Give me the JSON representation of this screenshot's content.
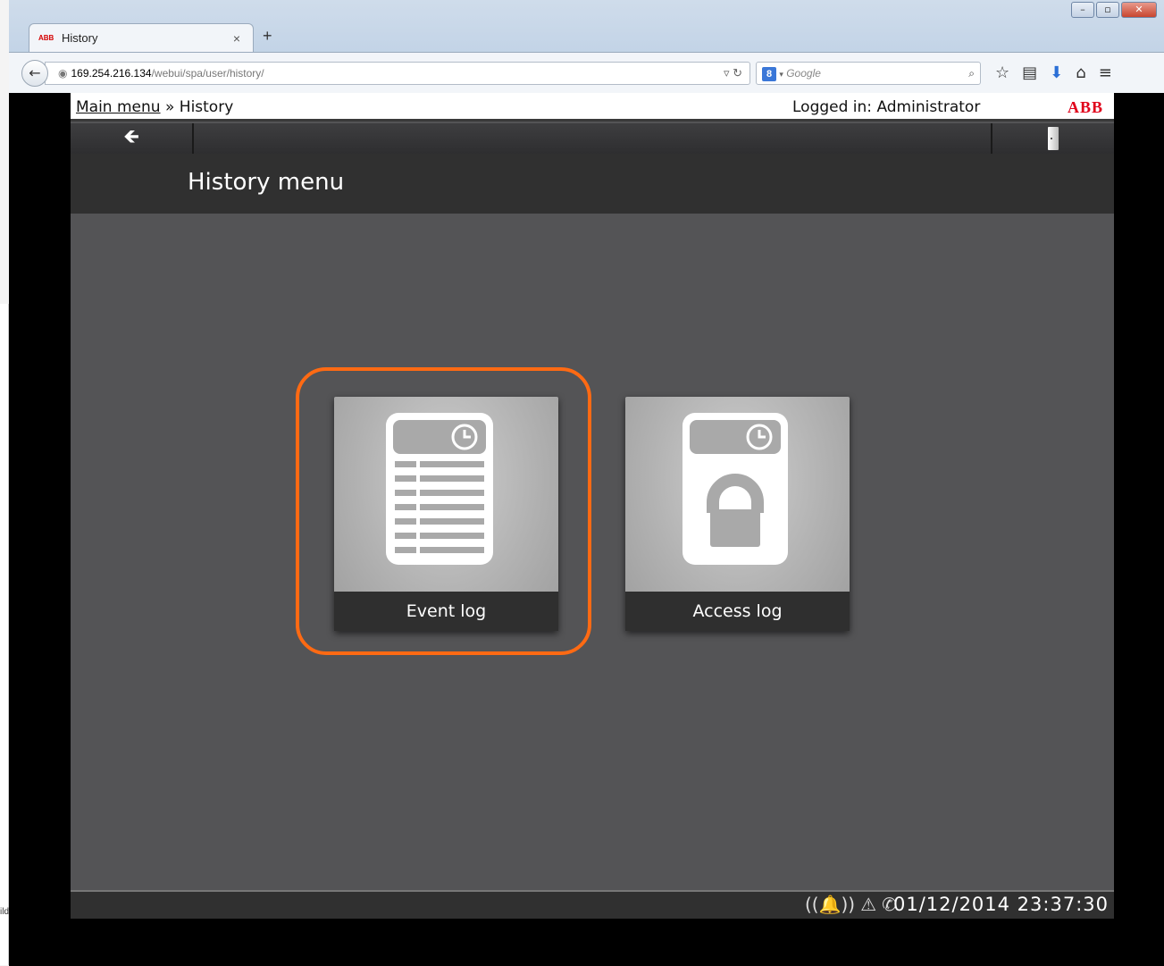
{
  "browser": {
    "tab_title": "History",
    "tab_favicon": "ABB",
    "tab_close": "×",
    "new_tab": "+",
    "url_host": "169.254.216.134",
    "url_path": "/webui/spa/user/history/",
    "search_placeholder": "Google",
    "window_buttons": [
      "minimize",
      "maximize",
      "close"
    ]
  },
  "app": {
    "breadcrumb_link": "Main menu",
    "breadcrumb_sep": " » ",
    "breadcrumb_current": "History",
    "logged_in": "Logged in: Administrator",
    "brand": "ABB",
    "page_title": "History menu",
    "tiles": [
      {
        "label": "Event log",
        "icon": "event-log-icon",
        "highlighted": true
      },
      {
        "label": "Access log",
        "icon": "access-log-icon",
        "highlighted": false
      }
    ],
    "datetime": "01/12/2014 23:37:30",
    "status_icons": [
      "alarm-icon",
      "warning-icon",
      "call-icon"
    ]
  },
  "underlying_window_text": "ild",
  "colors": {
    "highlight": "#ff6a13",
    "brand": "#e0001a",
    "background": "#545456"
  }
}
